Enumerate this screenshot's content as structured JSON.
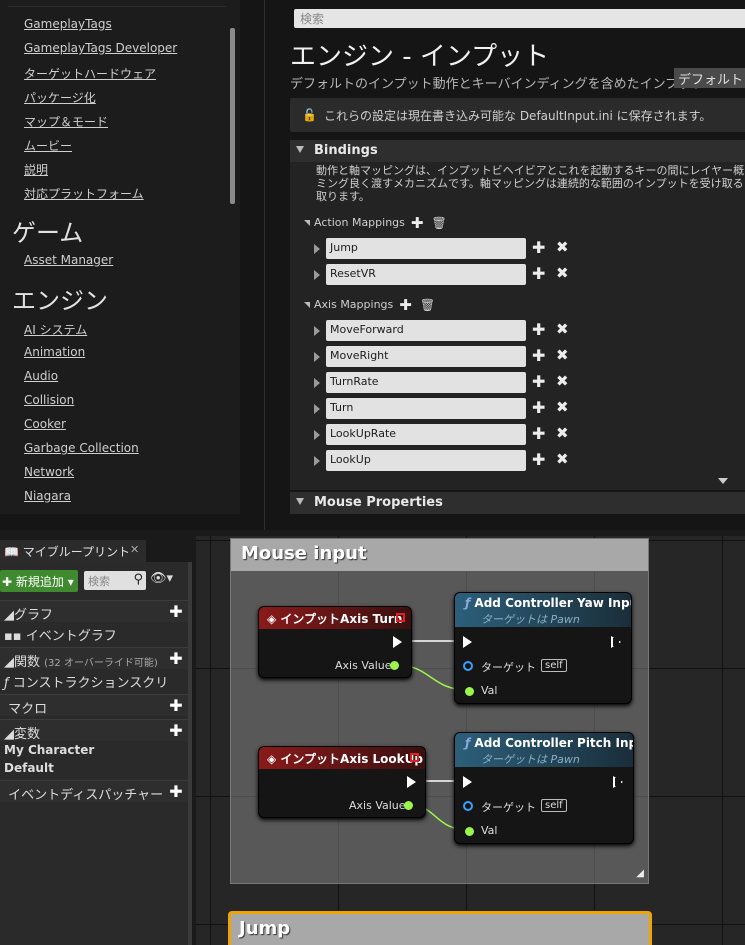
{
  "left_nav": {
    "top_items": [
      "GameplayTags",
      "GameplayTags Developer",
      "ターゲットハードウェア",
      "パッケージ化",
      "マップ＆モード",
      "ムービー",
      "説明",
      "対応プラットフォーム"
    ],
    "game_category": "ゲーム",
    "game_items": [
      "Asset Manager"
    ],
    "engine_category": "エンジン",
    "engine_items": [
      "AI システム",
      "Animation",
      "Audio",
      "Collision",
      "Cooker",
      "Garbage Collection",
      "Network",
      "Niagara"
    ]
  },
  "settings": {
    "search_placeholder": "検索",
    "title": "エンジン - インプット",
    "description": "デフォルトのインプット動作とキーバインディングを含めたインプット",
    "default_button": "デフォルトと",
    "info_text": "これらの設定は現在書き込み可能な DefaultInput.ini に保存されます。",
    "bindings_label": "Bindings",
    "bindings_desc": "動作と軸マッピングは、インプットビヘイビアとこれを起動するキーの間にレイヤー概\nミング良く渡すメカニズムです。軸マッピングは連続的な範囲のインプットを受け取る\n取ります。",
    "action_mappings_label": "Action Mappings",
    "action_mappings": [
      "Jump",
      "ResetVR"
    ],
    "axis_mappings_label": "Axis Mappings",
    "axis_mappings": [
      "MoveForward",
      "MoveRight",
      "TurnRate",
      "Turn",
      "LookUpRate",
      "LookUp"
    ],
    "mouse_properties_label": "Mouse Properties"
  },
  "blueprint": {
    "tab_label": "マイブループリント",
    "add_new": "新規追加",
    "search_placeholder": "検索",
    "graphs_label": "グラフ",
    "event_graph": "イベントグラフ",
    "functions_label": "関数",
    "functions_count": "(32 オーバーライド可能)",
    "construction_script": "コンストラクションスクリ",
    "macros_label": "マクロ",
    "variables_label": "変数",
    "variable_groups": [
      "My Character",
      "Default"
    ],
    "dispatchers_label": "イベントディスパッチャー"
  },
  "graph": {
    "comment_mouse": "Mouse input",
    "comment_jump": "Jump",
    "node_axis_turn": "インプットAxis Turn",
    "node_axis_lookup": "インプットAxis LookUp",
    "axis_value_label": "Axis Value",
    "node_yaw": "Add Controller Yaw Input",
    "node_pitch": "Add Controller Pitch Input",
    "target_is": "ターゲットは Pawn",
    "target_label": "ターゲット",
    "self_label": "self",
    "val_label": "Val"
  },
  "colors": {
    "event_header": "#8a1a1a",
    "function_header": "#2c5f7a",
    "float_pin": "#9cf54a",
    "object_pin": "#3aa0ff",
    "add_new_green": "#3f8a2f",
    "selected_comment": "#f0a400"
  }
}
